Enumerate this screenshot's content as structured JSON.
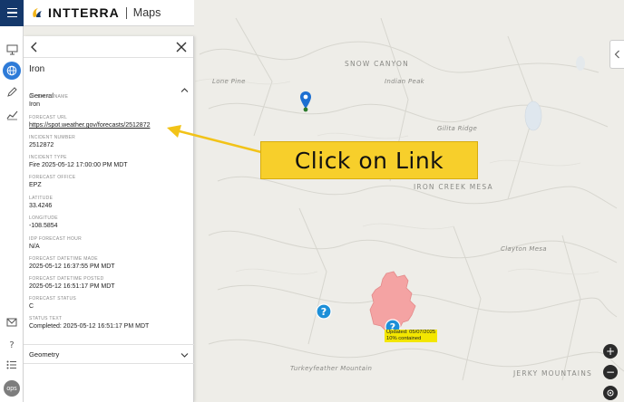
{
  "header": {
    "brand": "INTTERRA",
    "product": "Maps"
  },
  "rail": {
    "user_badge": "ops"
  },
  "panel": {
    "title": "Iron",
    "section_general": "General",
    "section_geometry": "Geometry",
    "fields": [
      {
        "label": "Incident Name",
        "value": "Iron"
      },
      {
        "label": "Forecast URL",
        "value": "https://spot.weather.gov/forecasts/2512872"
      },
      {
        "label": "Incident Number",
        "value": "2512872"
      },
      {
        "label": "Incident Type",
        "value": "Fire 2025-05-12 17:00:00 PM MDT"
      },
      {
        "label": "Forecast Office",
        "value": "EPZ"
      },
      {
        "label": "Latitude",
        "value": "33.4246"
      },
      {
        "label": "Longitude",
        "value": "-108.5854"
      },
      {
        "label": "IDP Forecast Hour",
        "value": "N/A"
      },
      {
        "label": "Forecast Datetime Made",
        "value": "2025-05-12 16:37:55 PM MDT"
      },
      {
        "label": "Forecast Datetime Posted",
        "value": "2025-05-12 16:51:17 PM MDT"
      },
      {
        "label": "Forecast Status",
        "value": "C"
      },
      {
        "label": "Status Text",
        "value": "Completed: 2025-05-12 16:51:17 PM MDT"
      }
    ]
  },
  "map": {
    "labels": {
      "snow_canyon": "SNOW CANYON",
      "iron_creek_mesa": "IRON CREEK MESA",
      "jerky_mountains": "JERKY MOUNTAINS",
      "gilita_ridge": "Gilita Ridge",
      "clayton_mesa": "Clayton Mesa",
      "turkeyfeather_mountain": "Turkeyfeather Mountain",
      "lone_pine": "Lone Pine",
      "indian_peak": "Indian Peak"
    },
    "fire_label_line1": "Updated: 05/07/2025",
    "fire_label_line2": "10% contained",
    "zoom_in": "+",
    "zoom_out": "−"
  },
  "callout": {
    "text": "Click on Link"
  },
  "colors": {
    "header_blue": "#14386b",
    "accent_blue": "#2e7bd8",
    "callout_yellow": "#f7cf2b",
    "fire_fill": "#f4a3a3",
    "marker_blue": "#1d8fd8"
  }
}
